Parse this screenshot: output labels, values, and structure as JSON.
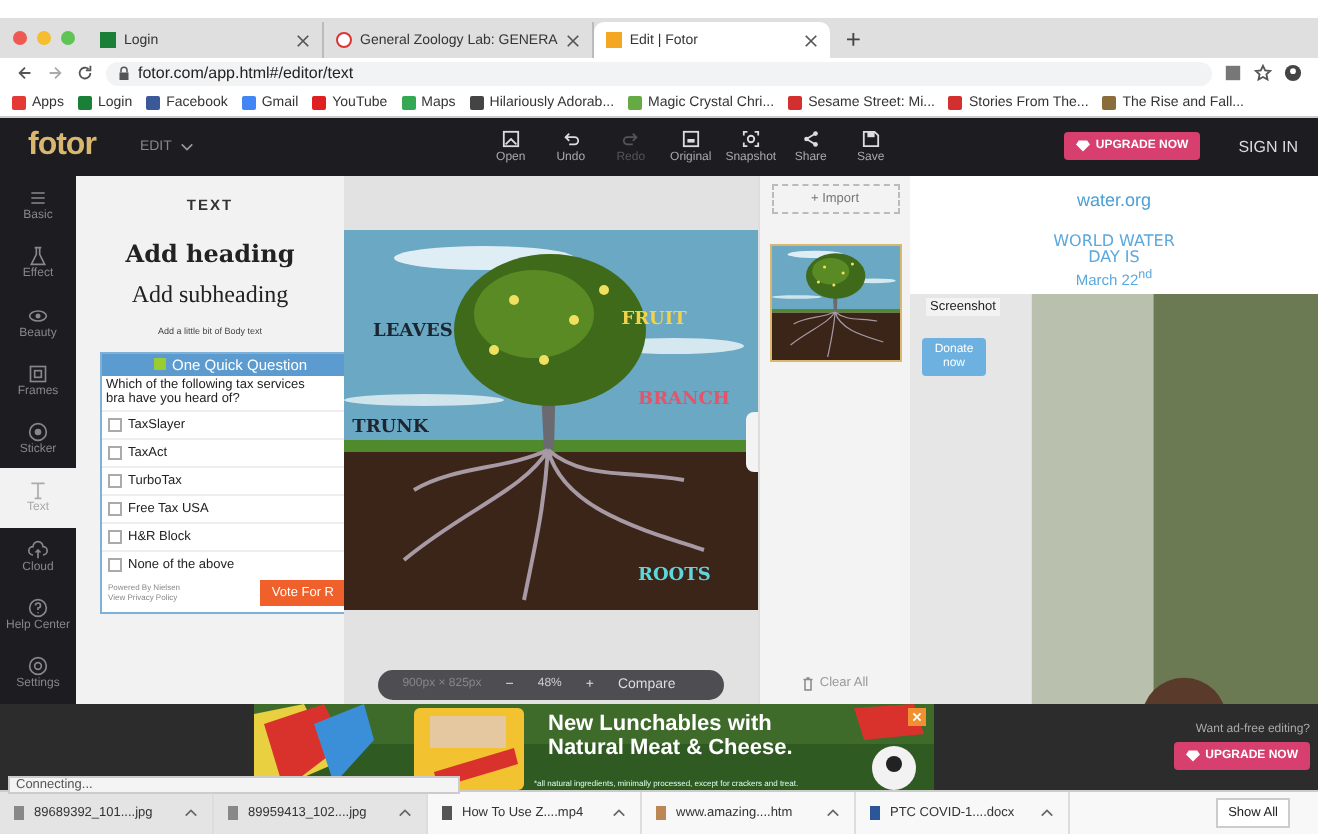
{
  "browser": {
    "tabs": [
      {
        "label": "Login",
        "selected": false
      },
      {
        "label": "General Zoology Lab: GENERA",
        "selected": false
      },
      {
        "label": "Edit | Fotor",
        "selected": true
      }
    ],
    "new_tab": "+",
    "url": "fotor.com/app.html#/editor/text",
    "bookmarks": [
      "Apps",
      "Login",
      "Facebook",
      "Gmail",
      "YouTube",
      "Maps",
      "Hilariously Adorab...",
      "Magic Crystal Chri...",
      "Sesame Street: Mi...",
      "Stories From The...",
      "The Rise and Fall..."
    ]
  },
  "app": {
    "logo": "fotor",
    "edit_menu": "EDIT",
    "tools": [
      {
        "label": "Open",
        "disabled": false
      },
      {
        "label": "Undo",
        "disabled": false
      },
      {
        "label": "Redo",
        "disabled": true
      },
      {
        "label": "Original",
        "disabled": false
      },
      {
        "label": "Snapshot",
        "disabled": false
      },
      {
        "label": "Share",
        "disabled": false
      },
      {
        "label": "Save",
        "disabled": false
      }
    ],
    "upgrade": "UPGRADE NOW",
    "sign_in": "SIGN IN"
  },
  "sidebar": {
    "items": [
      {
        "label": "Basic",
        "selected": false
      },
      {
        "label": "Effect",
        "selected": false
      },
      {
        "label": "Beauty",
        "selected": false
      },
      {
        "label": "Frames",
        "selected": false
      },
      {
        "label": "Sticker",
        "selected": false
      },
      {
        "label": "Text",
        "selected": true
      },
      {
        "label": "Cloud",
        "selected": false
      }
    ],
    "bottom": [
      "Help Center",
      "Settings"
    ]
  },
  "text_panel": {
    "title": "TEXT",
    "heading": "Add heading",
    "subheading": "Add subheading",
    "body": "Add a little bit of Body text"
  },
  "poll": {
    "title": "One Quick Question",
    "question": "Which of the following tax services bra have you heard of?",
    "options": [
      {
        "label": "TaxSlayer",
        "checked": false
      },
      {
        "label": "TaxAct",
        "checked": false
      },
      {
        "label": "TurboTax",
        "checked": false
      },
      {
        "label": "Free Tax USA",
        "checked": false
      },
      {
        "label": "H&R Block",
        "checked": false
      },
      {
        "label": "None of the above",
        "checked": false
      }
    ],
    "powered": "Powered By Nielsen",
    "privacy": "View Privacy Policy",
    "vote": "Vote For R"
  },
  "canvas": {
    "labels": [
      {
        "text": "LEAVES",
        "color": "#1c2530"
      },
      {
        "text": "FRUIT",
        "color": "#f2d24a"
      },
      {
        "text": "BRANCH",
        "color": "#e0566a"
      },
      {
        "text": "TRUNK",
        "color": "#1c2530"
      },
      {
        "text": "ROOTS",
        "color": "#5fd6dc"
      }
    ],
    "size": "900px × 825px",
    "zoom_out": "−",
    "zoom": "48%",
    "zoom_in": "+",
    "compare": "Compare"
  },
  "right_panel": {
    "import": "+ Import",
    "clear": "Clear All"
  },
  "side_ad": {
    "logo": "water.org",
    "headline": "WORLD WATER DAY IS",
    "date": "March 22$^{nd}$",
    "tooltip": "Screenshot",
    "donate": "Donate now"
  },
  "bottom_ad": {
    "headline": "New Lunchables with Natural Meat & Cheese.",
    "fine_print": "*all natural ingredients, minimally processed, except for crackers and treat."
  },
  "ad_free": {
    "prompt": "Want ad-free editing?",
    "upgrade": "UPGRADE NOW"
  },
  "status": "Connecting...",
  "downloads": {
    "items": [
      "89689392_101....jpg",
      "89959413_102....jpg",
      "How To Use Z....mp4",
      "www.amazing....htm",
      "PTC COVID-1....docx"
    ],
    "show_all": "Show All"
  }
}
